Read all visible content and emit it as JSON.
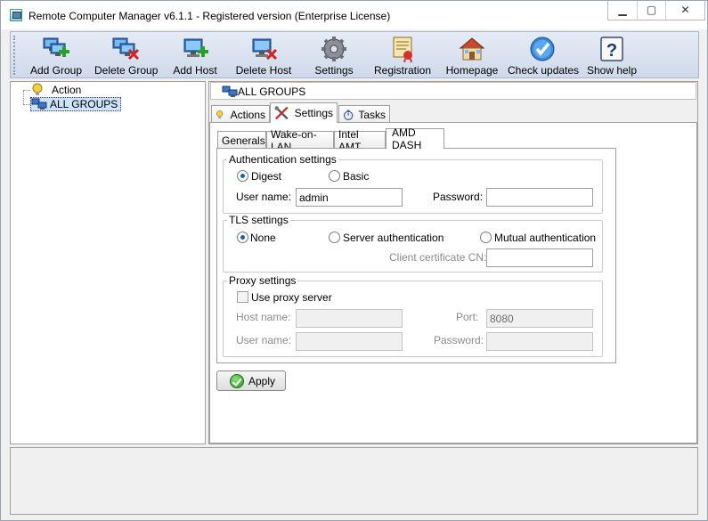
{
  "window": {
    "title": "Remote Computer Manager v6.1.1 - Registered version (Enterprise License)",
    "minimize_glyph": "▁",
    "maximize_glyph": "▢",
    "close_glyph": "✕"
  },
  "toolbar": [
    {
      "id": "add-group",
      "label": "Add Group",
      "icon": "add-group-icon"
    },
    {
      "id": "delete-group",
      "label": "Delete Group",
      "icon": "delete-group-icon"
    },
    {
      "id": "add-host",
      "label": "Add Host",
      "icon": "add-host-icon"
    },
    {
      "id": "delete-host",
      "label": "Delete Host",
      "icon": "delete-host-icon"
    },
    {
      "id": "settings",
      "label": "Settings",
      "icon": "gear-icon"
    },
    {
      "id": "registration",
      "label": "Registration",
      "icon": "registration-icon"
    },
    {
      "id": "homepage",
      "label": "Homepage",
      "icon": "home-icon"
    },
    {
      "id": "check-updates",
      "label": "Check updates",
      "icon": "check-icon"
    },
    {
      "id": "show-help",
      "label": "Show help",
      "icon": "help-icon"
    }
  ],
  "tree": {
    "items": [
      {
        "label": "Action",
        "icon": "bulb-icon"
      },
      {
        "label": "ALL GROUPS",
        "icon": "network-icon",
        "selected": true
      }
    ]
  },
  "header": {
    "title": "ALL GROUPS"
  },
  "main_tabs": [
    {
      "label": "Actions",
      "icon": "bulb-icon"
    },
    {
      "label": "Settings",
      "icon": "tools-icon",
      "active": true
    },
    {
      "label": "Tasks",
      "icon": "stopwatch-icon"
    }
  ],
  "sub_tabs": [
    {
      "label": "Generals"
    },
    {
      "label": "Wake-on-LAN"
    },
    {
      "label": "Intel AMT"
    },
    {
      "label": "AMD DASH",
      "active": true
    }
  ],
  "auth": {
    "title": "Authentication settings",
    "digest_label": "Digest",
    "basic_label": "Basic",
    "selected": "Digest",
    "username_label": "User name:",
    "username_value": "admin",
    "password_label": "Password:",
    "password_value": ""
  },
  "tls": {
    "title": "TLS settings",
    "none_label": "None",
    "server_label": "Server authentication",
    "mutual_label": "Mutual authentication",
    "selected": "None",
    "client_cn_label": "Client certificate CN:",
    "client_cn_value": ""
  },
  "proxy": {
    "title": "Proxy settings",
    "use_proxy_label": "Use proxy server",
    "use_proxy_checked": false,
    "host_label": "Host name:",
    "host_value": "",
    "port_label": "Port:",
    "port_value": "8080",
    "user_label": "User name:",
    "user_value": "",
    "password_label": "Password:",
    "password_value": ""
  },
  "apply_label": "Apply",
  "colors": {
    "toolbar_bg": "#d6deee",
    "selection_bg": "#cce4f7",
    "radio_dot": "#1a60b0"
  }
}
